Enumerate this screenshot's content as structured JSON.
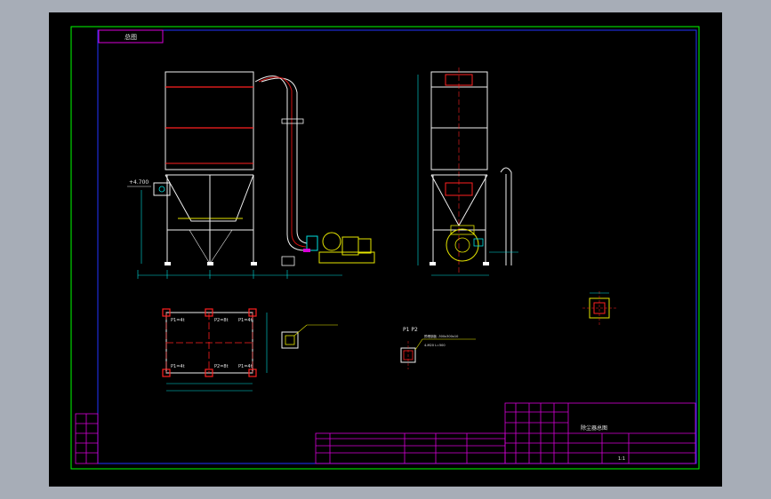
{
  "drawing_area": {
    "background": "#000000",
    "surround": "#a7adb7"
  },
  "colors": {
    "outer_border": "#00ff00",
    "inner_border": "#2233ff",
    "title_block": "#d800d8",
    "structure": "#f0f0f0",
    "accent": "#d01010",
    "dimension": "#00e0e0",
    "text": "#e8e8e8",
    "yellow": "#e6e600"
  },
  "labels": {
    "corner_tag": "总图",
    "elevation_mark": "+4.700",
    "plan_point_tl": "P1=4t",
    "plan_point_tm": "P2=8t",
    "plan_point_tr": "P1=4t",
    "plan_point_bl": "P1=4t",
    "plan_point_bm": "P2=8t",
    "plan_point_br": "P1=4t",
    "detail_title": "P1 P2",
    "detail_note_1": "预埋钢板 -300x300x10",
    "detail_note_2": "4-M20 L=500",
    "title_block_name": "除尘器总图",
    "scale": "1:1"
  }
}
